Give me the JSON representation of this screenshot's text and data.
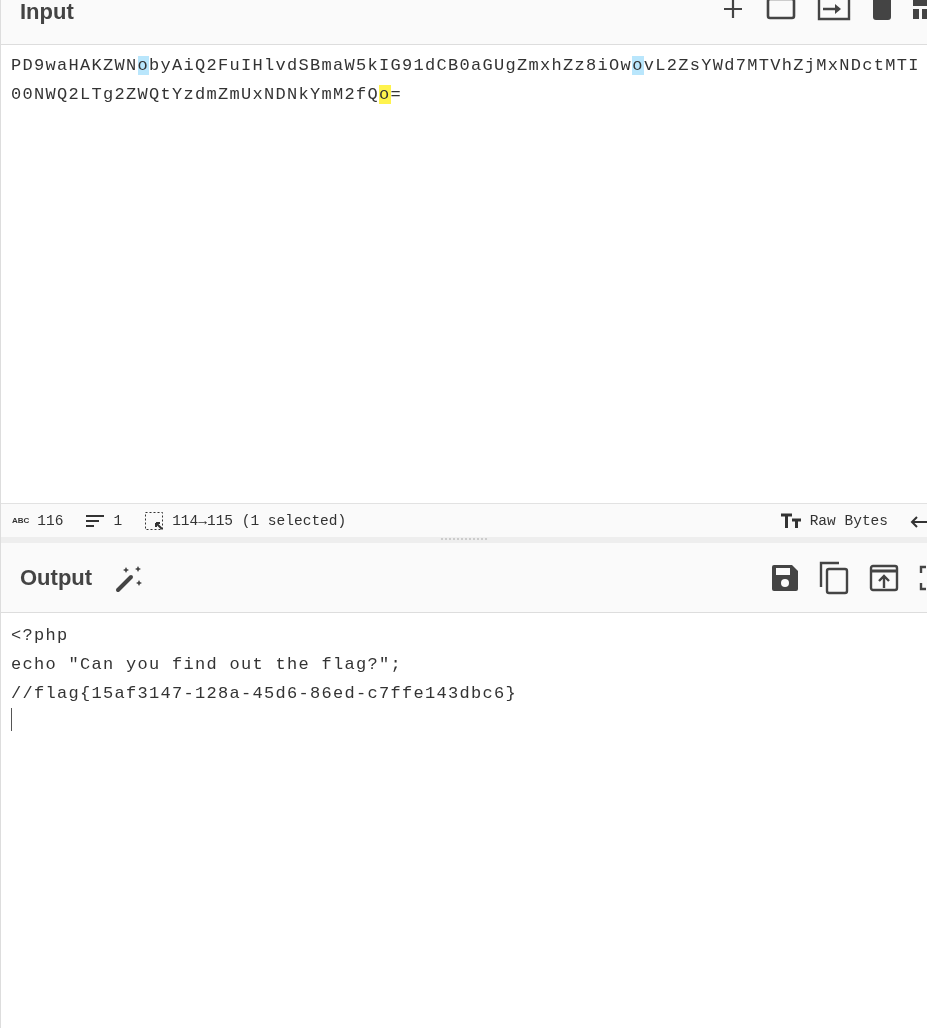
{
  "input": {
    "title": "Input",
    "lines": [
      [
        {
          "text": "PD9waHAKZWN",
          "matched": false,
          "selected": false
        },
        {
          "text": "o",
          "matched": true,
          "selected": false
        },
        {
          "text": "byAiQ2FuIHlvdSBmaW5kIG91dCB0aGUgZmxhZz8iOw",
          "matched": false,
          "selected": false
        },
        {
          "text": "o",
          "matched": true,
          "selected": false
        },
        {
          "text": "vL2ZsYWd7MTVhZjMxNDctMTI",
          "matched": false,
          "selected": false
        }
      ],
      [
        {
          "text": "00NWQ2LTg2ZWQtYzdmZmUxNDNkYmM2fQ",
          "matched": false,
          "selected": false
        },
        {
          "text": "o",
          "matched": false,
          "selected": true
        },
        {
          "text": "=",
          "matched": false,
          "selected": false
        }
      ]
    ]
  },
  "status_bar": {
    "length_label": "ABC",
    "length": "116",
    "lines": "1",
    "selection": "114→115 (1 selected)",
    "encoding": "Raw Bytes"
  },
  "output": {
    "title": "Output",
    "lines": [
      "<?php",
      "echo \"Can you find out the flag?\";",
      "//flag{15af3147-128a-45d6-86ed-c7ffe143dbc6}"
    ]
  }
}
